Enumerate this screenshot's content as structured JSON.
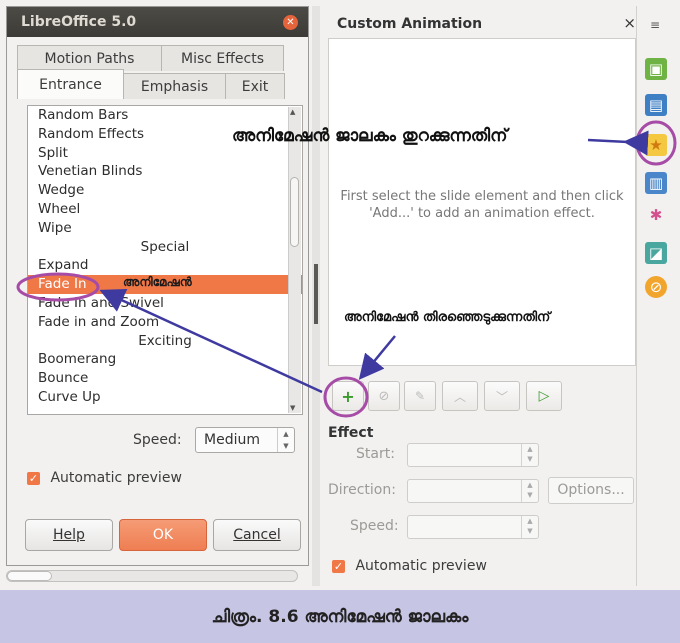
{
  "dialog": {
    "title": "LibreOffice 5.0",
    "tabs_top": [
      "Motion Paths",
      "Misc Effects"
    ],
    "tabs_bottom": [
      "Entrance",
      "Emphasis",
      "Exit"
    ],
    "effects": [
      {
        "label": "Random Bars",
        "kind": "item"
      },
      {
        "label": "Random Effects",
        "kind": "item"
      },
      {
        "label": "Split",
        "kind": "item"
      },
      {
        "label": "Venetian Blinds",
        "kind": "item"
      },
      {
        "label": "Wedge",
        "kind": "item"
      },
      {
        "label": "Wheel",
        "kind": "item"
      },
      {
        "label": "Wipe",
        "kind": "item"
      },
      {
        "label": "Special",
        "kind": "category"
      },
      {
        "label": "Expand",
        "kind": "item"
      },
      {
        "label": "Fade In",
        "kind": "selected"
      },
      {
        "label": "Fade In and Swivel",
        "kind": "item"
      },
      {
        "label": "Fade in and Zoom",
        "kind": "item"
      },
      {
        "label": "Exciting",
        "kind": "category"
      },
      {
        "label": "Boomerang",
        "kind": "item"
      },
      {
        "label": "Bounce",
        "kind": "item"
      },
      {
        "label": "Curve Up",
        "kind": "item"
      }
    ],
    "speed_label": "Speed:",
    "speed_value": "Medium",
    "auto_preview": "Automatic preview",
    "help": "Help",
    "ok": "OK",
    "cancel": "Cancel"
  },
  "panel": {
    "title": "Custom Animation",
    "close": "×",
    "hint": "First select the slide element and then click 'Add...' to add an animation effect.",
    "effect_heading": "Effect",
    "start_label": "Start:",
    "direction_label": "Direction:",
    "options_label": "Options...",
    "speed_label": "Speed:",
    "auto_preview": "Automatic preview"
  },
  "annotations": {
    "open_window": "അനിമേഷൻ ജാലകം തുറക്കുന്നതിന്",
    "selected_effect": "അനിമേഷൻ",
    "select_animation": "അനിമേഷൻ തിരഞ്ഞെടുക്കുന്നതിന്"
  },
  "caption": "ചിത്രം. 8.6 അനിമേഷൻ ജാലകം",
  "colors": {
    "accent": "#f07746",
    "annotation": "#3f3aa0",
    "highlight_ring": "#a64ca6",
    "caption_bg": "#c7c5e4"
  }
}
